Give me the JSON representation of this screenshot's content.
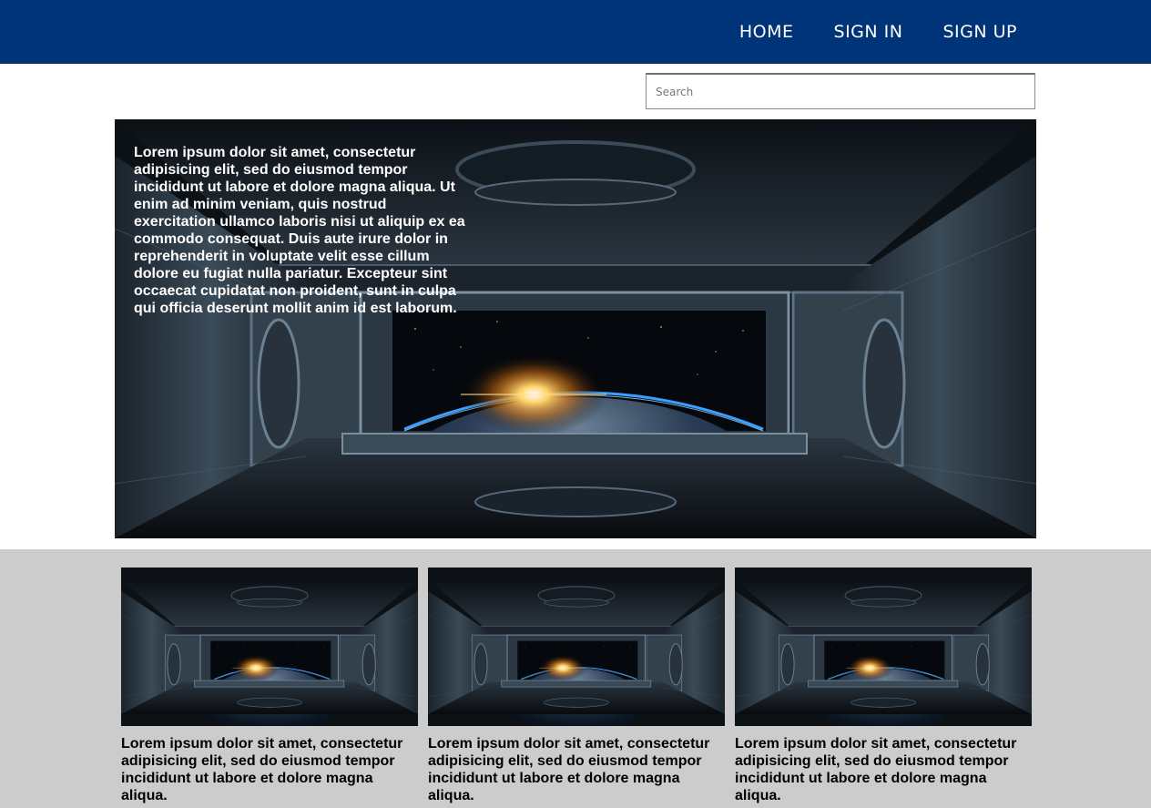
{
  "nav": {
    "home": "HOME",
    "sign_in": "SIGN IN",
    "sign_up": "SIGN UP"
  },
  "search": {
    "placeholder": "Search",
    "value": ""
  },
  "hero": {
    "text": "Lorem ipsum dolor sit amet, consectetur adipisicing elit, sed do eiusmod tempor incididunt ut labore et dolore magna aliqua. Ut enim ad minim veniam, quis nostrud exercitation ullamco laboris nisi ut aliquip ex ea commodo consequat. Duis aute irure dolor in reprehenderit in voluptate velit esse cillum dolore eu fugiat nulla pariatur. Excepteur sint occaecat cupidatat non proident, sunt in culpa qui officia deserunt mollit anim id est laborum."
  },
  "cards": [
    {
      "text": "Lorem ipsum dolor sit amet, consectetur adipisicing elit, sed do eiusmod tempor incididunt ut labore et dolore magna aliqua."
    },
    {
      "text": "Lorem ipsum dolor sit amet, consectetur adipisicing elit, sed do eiusmod tempor incididunt ut labore et dolore magna aliqua."
    },
    {
      "text": "Lorem ipsum dolor sit amet, consectetur adipisicing elit, sed do eiusmod tempor incididunt ut labore et dolore magna aliqua."
    }
  ],
  "colors": {
    "header": "#003478",
    "section_bg": "#cccccc"
  }
}
